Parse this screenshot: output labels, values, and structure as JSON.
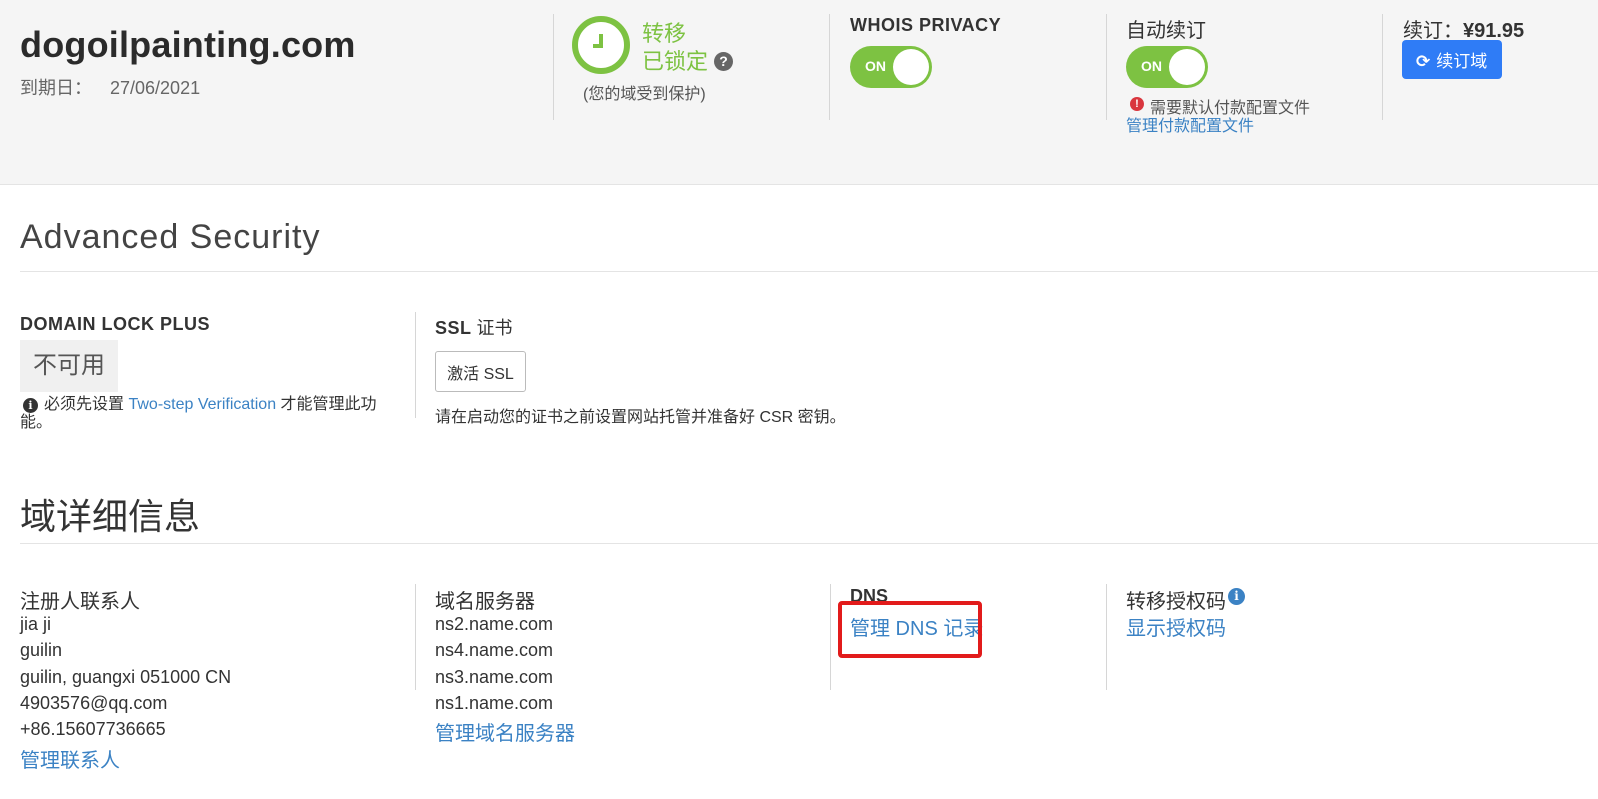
{
  "header": {
    "domain": "dogoilpainting.com",
    "expiry_label": "到期日：",
    "expiry_date": "27/06/2021",
    "transfer": {
      "title": "转移",
      "status": "已锁定",
      "help_icon": "question-circle-icon",
      "note": "(您的域受到保护)"
    },
    "whois": {
      "label": "WHOIS PRIVACY",
      "toggle_text": "ON",
      "enabled": true
    },
    "auto_renew": {
      "label": "自动续订",
      "toggle_text": "ON",
      "enabled": true,
      "warning": "需要默认付款配置文件",
      "warning_icon": "exclamation-circle-icon",
      "manage_link": "管理付款配置文件"
    },
    "renew": {
      "price_label": "续订：",
      "price": "¥91.95",
      "button_label": "续订域",
      "button_icon": "refresh-icon"
    }
  },
  "advanced_security": {
    "title": "Advanced Security",
    "domain_lock_plus": {
      "label": "DOMAIN LOCK PLUS",
      "status": "不可用",
      "note_prefix": "必须先设置",
      "note_link": "Two-step Verification",
      "note_suffix": "才能管理此功能。"
    },
    "ssl": {
      "label_bold": "SSL",
      "label_rest": " 证书",
      "button_label": "激活 SSL",
      "note": "请在启动您的证书之前设置网站托管并准备好 CSR 密钥。"
    }
  },
  "domain_details": {
    "title": "域详细信息",
    "registrant": {
      "label": "注册人联系人",
      "lines": [
        "jia ji",
        "guilin",
        "guilin, guangxi 051000 CN",
        "4903576@qq.com",
        "+86.15607736665"
      ],
      "manage_link": "管理联系人"
    },
    "nameservers": {
      "label": "域名服务器",
      "servers": [
        "ns2.name.com",
        "ns4.name.com",
        "ns3.name.com",
        "ns1.name.com"
      ],
      "manage_link": "管理域名服务器"
    },
    "dns": {
      "label": "DNS",
      "manage_link": "管理 DNS 记录"
    },
    "auth_code": {
      "label": "转移授权码",
      "info_icon": "info-circle-icon",
      "show_link": "显示授权码"
    }
  },
  "colors": {
    "green": "#7dc242",
    "link": "#3b82c4",
    "primary_button": "#2f7cf6",
    "highlight": "#e21b1b"
  }
}
